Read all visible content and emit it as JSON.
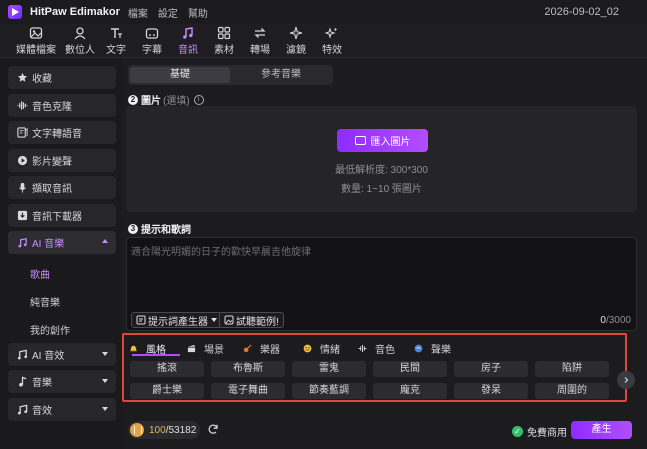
{
  "app": {
    "name": "HitPaw Edimakor",
    "project_name": "2026-09-02_02"
  },
  "menu": [
    "檔案",
    "設定",
    "幫助"
  ],
  "toolbar": [
    {
      "label": "媒體檔案",
      "icon": "media-icon"
    },
    {
      "label": "數位人",
      "icon": "avatar-icon"
    },
    {
      "label": "文字",
      "icon": "text-icon"
    },
    {
      "label": "字幕",
      "icon": "subtitle-icon"
    },
    {
      "label": "音訊",
      "icon": "audio-icon",
      "active": true
    },
    {
      "label": "素材",
      "icon": "material-icon"
    },
    {
      "label": "轉場",
      "icon": "transition-icon"
    },
    {
      "label": "濾鏡",
      "icon": "filter-icon"
    },
    {
      "label": "特效",
      "icon": "effect-icon"
    }
  ],
  "sidebar": {
    "items": [
      {
        "label": "收藏",
        "icon": "star-icon"
      },
      {
        "label": "音色克隆",
        "icon": "waveform-icon"
      },
      {
        "label": "文字轉語音",
        "icon": "text-to-speech-icon"
      },
      {
        "label": "影片變聲",
        "icon": "voice-changer-icon"
      },
      {
        "label": "擷取音訊",
        "icon": "microphone-icon"
      },
      {
        "label": "音訊下載器",
        "icon": "download-icon"
      },
      {
        "label": "AI 音樂",
        "icon": "ai-music-icon"
      },
      {
        "label": "AI 音效",
        "icon": "ai-sfx-icon"
      },
      {
        "label": "音樂",
        "icon": "music-note-icon"
      },
      {
        "label": "音效",
        "icon": "sound-effect-icon"
      }
    ],
    "ai_music_sub": [
      "歌曲",
      "純音樂",
      "我的創作"
    ]
  },
  "main": {
    "tabs": [
      "基礎",
      "參考音樂"
    ],
    "image_section": {
      "number": "2",
      "title": "圖片",
      "optional": "(選填)",
      "import_label": "匯入圖片",
      "min_res": "最低解析度:   300*300",
      "count": "數量: 1~10 張圖片"
    },
    "prompt_section": {
      "number": "3",
      "title": "提示和歌詞",
      "placeholder": "適合陽光明媚的日子的歡快早晨吉他旋律",
      "generator_label": "提示詞產生器",
      "example_label": "試聽範例!",
      "count_current": "0",
      "count_max": "/3000"
    },
    "tag_tabs": [
      "風格",
      "場景",
      "樂器",
      "情緒",
      "音色",
      "聲樂"
    ],
    "tag_chips": [
      [
        "搖滾",
        "布魯斯",
        "雷鬼",
        "民間",
        "房子",
        "陷阱"
      ],
      [
        "爵士樂",
        "電子舞曲",
        "節奏藍調",
        "龐克",
        "發呆",
        "周圍的"
      ]
    ]
  },
  "footer": {
    "credits_used": "100",
    "credits_total": "/53182",
    "free_label": "免費商用",
    "generate_label": "產生"
  },
  "colors": {
    "accent": "#b04dff",
    "highlight_border": "#e0463c",
    "coin": "#e0a54a",
    "free_icon": "#33c06a"
  }
}
